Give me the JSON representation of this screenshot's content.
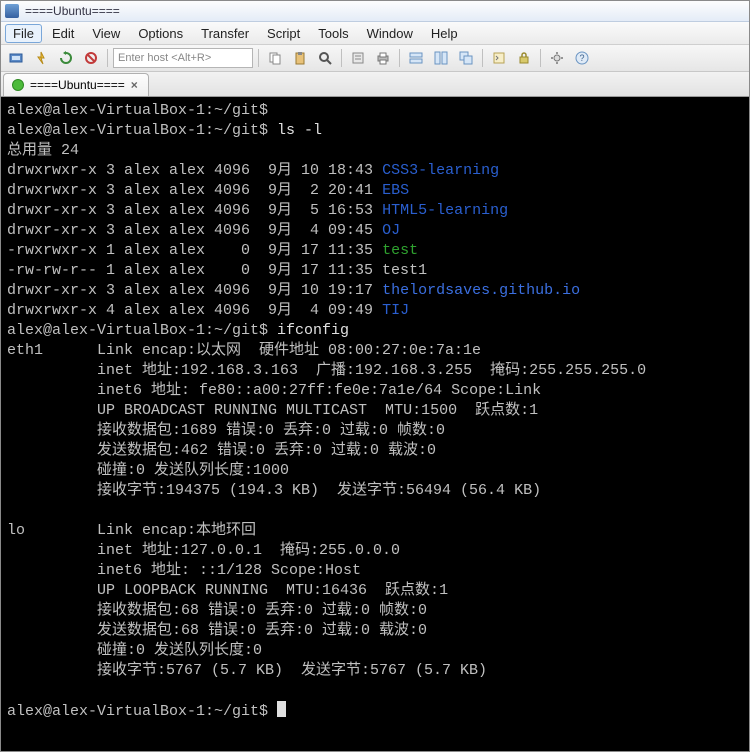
{
  "window": {
    "title": "====Ubuntu===="
  },
  "menu": {
    "items": [
      "File",
      "Edit",
      "View",
      "Options",
      "Transfer",
      "Script",
      "Tools",
      "Window",
      "Help"
    ],
    "active_index": 0
  },
  "toolbar": {
    "host_placeholder": "Enter host <Alt+R>"
  },
  "tab": {
    "label": "====Ubuntu====",
    "close": "×"
  },
  "prompt": {
    "user_host": "alex@alex-VirtualBox-1",
    "path": "~/git",
    "sep": "$"
  },
  "cmds": {
    "ls": "ls -l",
    "ifconfig": "ifconfig"
  },
  "ls": {
    "total_line": "总用量 24",
    "rows": [
      {
        "perm": "drwxrwxr-x",
        "lnk": "3",
        "own": "alex",
        "grp": "alex",
        "size": "4096",
        "mon": "9月",
        "day": "10",
        "time": "18:43",
        "name": "CSS3-learning",
        "cls": "f-blue"
      },
      {
        "perm": "drwxrwxr-x",
        "lnk": "3",
        "own": "alex",
        "grp": "alex",
        "size": "4096",
        "mon": "9月",
        "day": "2",
        "time": "20:41",
        "name": "EBS",
        "cls": "f-blue"
      },
      {
        "perm": "drwxr-xr-x",
        "lnk": "3",
        "own": "alex",
        "grp": "alex",
        "size": "4096",
        "mon": "9月",
        "day": "5",
        "time": "16:53",
        "name": "HTML5-learning",
        "cls": "f-blue"
      },
      {
        "perm": "drwxr-xr-x",
        "lnk": "3",
        "own": "alex",
        "grp": "alex",
        "size": "4096",
        "mon": "9月",
        "day": "4",
        "time": "09:45",
        "name": "OJ",
        "cls": "f-blue"
      },
      {
        "perm": "-rwxrwxr-x",
        "lnk": "1",
        "own": "alex",
        "grp": "alex",
        "size": "0",
        "mon": "9月",
        "day": "17",
        "time": "11:35",
        "name": "test",
        "cls": "f-grn"
      },
      {
        "perm": "-rw-rw-r--",
        "lnk": "1",
        "own": "alex",
        "grp": "alex",
        "size": "0",
        "mon": "9月",
        "day": "17",
        "time": "11:35",
        "name": "test1",
        "cls": ""
      },
      {
        "perm": "drwxr-xr-x",
        "lnk": "3",
        "own": "alex",
        "grp": "alex",
        "size": "4096",
        "mon": "9月",
        "day": "10",
        "time": "19:17",
        "name": "thelordsaves.github.io",
        "cls": "f-blue2"
      },
      {
        "perm": "drwxrwxr-x",
        "lnk": "4",
        "own": "alex",
        "grp": "alex",
        "size": "4096",
        "mon": "9月",
        "day": "4",
        "time": "09:49",
        "name": "TIJ",
        "cls": "f-blue"
      }
    ]
  },
  "ifconfig": {
    "eth": {
      "name": "eth1",
      "l1": "Link encap:以太网  硬件地址 08:00:27:0e:7a:1e",
      "l2": "inet 地址:192.168.3.163  广播:192.168.3.255  掩码:255.255.255.0",
      "l3": "inet6 地址: fe80::a00:27ff:fe0e:7a1e/64 Scope:Link",
      "l4": "UP BROADCAST RUNNING MULTICAST  MTU:1500  跃点数:1",
      "l5": "接收数据包:1689 错误:0 丢弃:0 过载:0 帧数:0",
      "l6": "发送数据包:462 错误:0 丢弃:0 过载:0 载波:0",
      "l7": "碰撞:0 发送队列长度:1000",
      "l8": "接收字节:194375 (194.3 KB)  发送字节:56494 (56.4 KB)"
    },
    "lo": {
      "name": "lo",
      "l1": "Link encap:本地环回",
      "l2": "inet 地址:127.0.0.1  掩码:255.0.0.0",
      "l3": "inet6 地址: ::1/128 Scope:Host",
      "l4": "UP LOOPBACK RUNNING  MTU:16436  跃点数:1",
      "l5": "接收数据包:68 错误:0 丢弃:0 过载:0 帧数:0",
      "l6": "发送数据包:68 错误:0 丢弃:0 过载:0 载波:0",
      "l7": "碰撞:0 发送队列长度:0",
      "l8": "接收字节:5767 (5.7 KB)  发送字节:5767 (5.7 KB)"
    }
  }
}
